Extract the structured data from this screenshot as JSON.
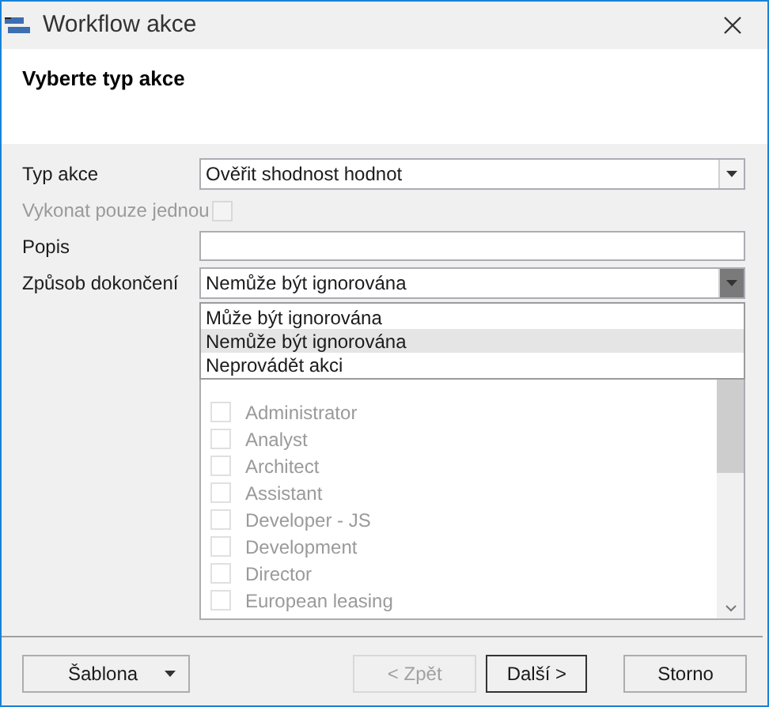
{
  "window": {
    "title": "Workflow akce"
  },
  "header": {
    "title": "Vyberte typ akce"
  },
  "form": {
    "action_type": {
      "label": "Typ akce",
      "value": "Ověřit shodnost hodnot"
    },
    "once": {
      "label": "Vykonat pouze jednou",
      "checked": false,
      "disabled": true
    },
    "description": {
      "label": "Popis"
    },
    "completion": {
      "label": "Způsob dokončení",
      "value": "Nemůže být ignorována",
      "expanded": true,
      "options": [
        {
          "label": "Může být ignorována",
          "selected": false
        },
        {
          "label": "Nemůže být ignorována",
          "selected": true
        },
        {
          "label": "Neprovádět akci",
          "selected": false
        }
      ]
    }
  },
  "roles": [
    {
      "label": "Administrator",
      "checked": false
    },
    {
      "label": "Analyst",
      "checked": false
    },
    {
      "label": "Architect",
      "checked": false
    },
    {
      "label": "Assistant",
      "checked": false
    },
    {
      "label": "Developer - JS",
      "checked": false
    },
    {
      "label": "Development",
      "checked": false
    },
    {
      "label": "Director",
      "checked": false
    },
    {
      "label": "European leasing",
      "checked": false
    }
  ],
  "buttons": [
    {
      "label": "Šablona",
      "kind": "split",
      "disabled": false,
      "default": false
    },
    {
      "label": "< Zpět",
      "kind": "plain",
      "disabled": true,
      "default": false
    },
    {
      "label": "Další >",
      "kind": "plain",
      "disabled": false,
      "default": true
    },
    {
      "label": "Storno",
      "kind": "plain",
      "disabled": false,
      "default": false
    }
  ]
}
